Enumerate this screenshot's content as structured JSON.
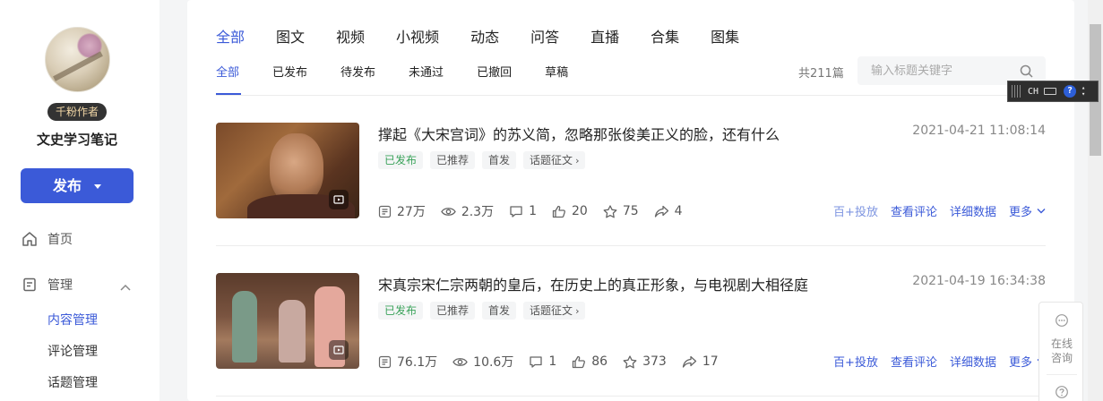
{
  "sidebar": {
    "badge": "千粉作者",
    "author_name": "文史学习笔记",
    "publish_label": "发布",
    "home_label": "首页",
    "manage_label": "管理",
    "sub_items": [
      "内容管理",
      "评论管理",
      "话题管理"
    ]
  },
  "tabs": {
    "top": [
      "全部",
      "图文",
      "视频",
      "小视频",
      "动态",
      "问答",
      "直播",
      "合集",
      "图集"
    ],
    "sub": [
      "全部",
      "已发布",
      "待发布",
      "未通过",
      "已撤回",
      "草稿"
    ]
  },
  "toolbar": {
    "total": "共211篇",
    "search_placeholder": "输入标题关键字"
  },
  "articles": [
    {
      "title": "撑起《大宋宫词》的苏义简，忽略那张俊美正义的脸，还有什么",
      "date": "2021-04-21 11:08:14",
      "tags": [
        "已发布",
        "已推荐",
        "首发",
        "话题征文"
      ],
      "stats": {
        "impressions": "27万",
        "views": "2.3万",
        "comments": "1",
        "likes": "20",
        "favorites": "75",
        "shares": "4"
      }
    },
    {
      "title": "宋真宗宋仁宗两朝的皇后，在历史上的真正形象，与电视剧大相径庭",
      "date": "2021-04-19 16:34:38",
      "tags": [
        "已发布",
        "已推荐",
        "首发",
        "话题征文"
      ],
      "stats": {
        "impressions": "76.1万",
        "views": "10.6万",
        "comments": "1",
        "likes": "86",
        "favorites": "373",
        "shares": "17"
      }
    }
  ],
  "actions": {
    "promote": "百+投放",
    "view_comments": "查看评论",
    "details": "详细数据",
    "more": "更多"
  },
  "ime": {
    "lang": "CH"
  },
  "consult": {
    "label_1": "在线",
    "label_2": "咨询"
  },
  "colors": {
    "accent": "#3b5ad8",
    "status_green": "#3aa25a"
  }
}
